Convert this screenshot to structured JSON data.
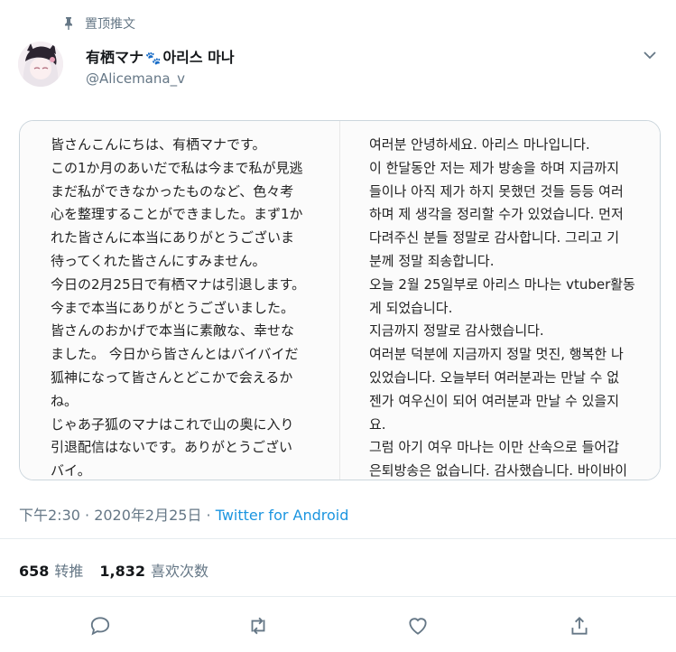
{
  "pinned_label": "置顶推文",
  "author": {
    "name": "有栖マナ",
    "name_suffix": "아리스 마나",
    "handle": "@Alicemana_v"
  },
  "media_text": {
    "japanese": [
      "皆さんこんにちは、有栖マナです。",
      "この1か月のあいだで私は今まで私が見逃",
      "まだ私ができなかったものなど、色々考",
      "心を整理することができました。まず1か",
      "れた皆さんに本当にありがとうございま",
      "待ってくれた皆さんにすみません。",
      "今日の2月25日で有栖マナは引退します。",
      "今まで本当にありがとうございました。",
      "皆さんのおかげで本当に素敵な、幸せな",
      "ました。 今日から皆さんとはバイバイだ",
      "狐神になって皆さんとどこかで会えるか",
      "ね。",
      "じゃあ子狐のマナはこれで山の奥に入り",
      "引退配信はないです。ありがとうござい",
      "バイ。"
    ],
    "korean": [
      "여러분 안녕하세요. 아리스 마나입니다.",
      "이 한달동안 저는 제가 방송을 하며 지금까지",
      "들이나 아직 제가 하지 못했던 것들 등등 여러",
      "하며 제 생각을 정리할 수가 있었습니다. 먼저",
      "다려주신 분들 정말로 감사합니다. 그리고 기",
      "분께 정말 죄송합니다.",
      "오늘 2월 25일부로 아리스 마나는 vtuber활동",
      "게 되었습니다.",
      "지금까지 정말로 감사했습니다.",
      "여러분 덕분에 지금까지 정말 멋진, 행복한 나",
      "있었습니다. 오늘부터 여러분과는 만날 수 없",
      "젠가 여우신이 되어 여러분과 만날 수 있을지",
      "요.",
      "그럼 아기 여우 마나는 이만 산속으로 들어갑",
      "은퇴방송은 없습니다. 감사했습니다. 바이바이"
    ]
  },
  "meta": {
    "time": "下午2:30 · 2020年2月25日 · ",
    "source": "Twitter for Android"
  },
  "stats": {
    "retweets_count": "658",
    "retweets_label": "转推",
    "likes_count": "1,832",
    "likes_label": "喜欢次数"
  },
  "colors": {
    "link": "#1b95e0",
    "secondary": "#657786",
    "border": "#e6ecf0"
  }
}
